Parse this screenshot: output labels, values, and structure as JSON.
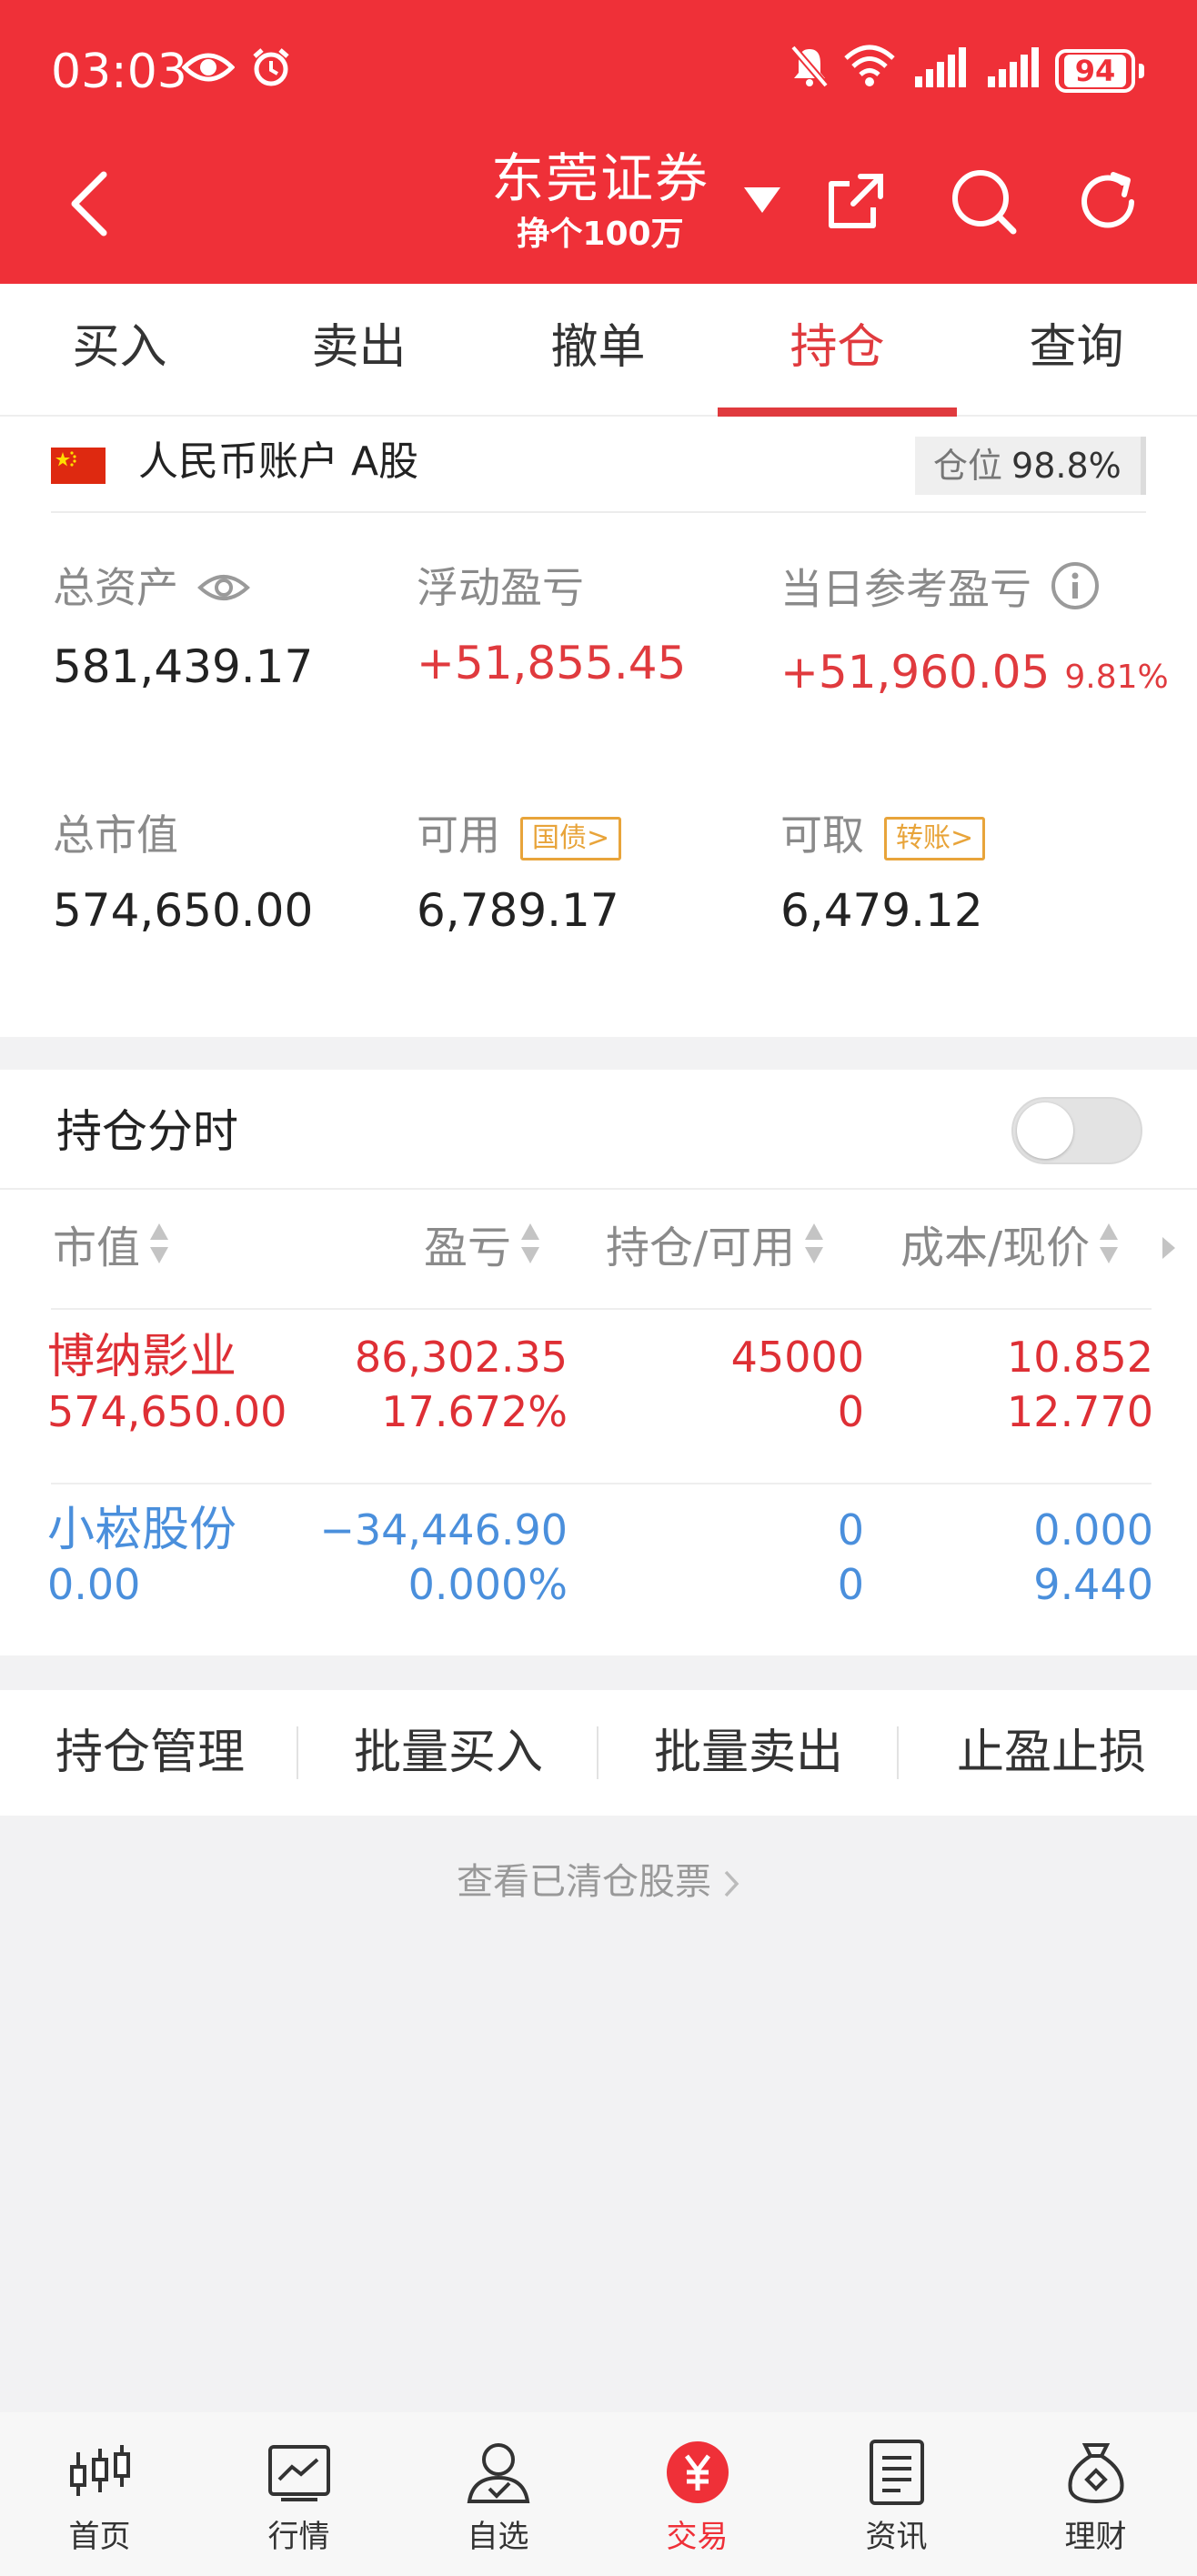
{
  "status_bar": {
    "time": "03:03",
    "battery": "94",
    "icons": [
      "eye-icon",
      "alarm-icon",
      "bell-off-icon",
      "wifi-icon",
      "signal-icon",
      "signal-icon",
      "battery-icon"
    ]
  },
  "nav": {
    "title": "东莞证券",
    "subtitle": "挣个100万",
    "icons": [
      "back-icon",
      "dropdown-caret-icon",
      "share-icon",
      "search-icon",
      "refresh-icon"
    ]
  },
  "tabs": [
    {
      "label": "买入"
    },
    {
      "label": "卖出"
    },
    {
      "label": "撤单"
    },
    {
      "label": "持仓",
      "active": true
    },
    {
      "label": "查询"
    }
  ],
  "account": {
    "name": "人民币账户 A股",
    "position_label": "仓位",
    "position_value": "98.8%",
    "total_assets_label": "总资产",
    "total_assets": "581,439.17",
    "floating_pl_label": "浮动盈亏",
    "floating_pl": "+51,855.45",
    "daily_pl_label": "当日参考盈亏",
    "daily_pl": "+51,960.05",
    "daily_pl_pct": "9.81%",
    "market_value_label": "总市值",
    "market_value": "574,650.00",
    "available_label": "可用",
    "available_tag": "国债>",
    "available": "6,789.17",
    "withdrawable_label": "可取",
    "withdrawable_tag": "转账>",
    "withdrawable": "6,479.12"
  },
  "holdings": {
    "title": "持仓分时",
    "toggle_on": false,
    "columns": [
      "市值",
      "盈亏",
      "持仓/可用",
      "成本/现价"
    ],
    "rows": [
      {
        "name": "博纳影业",
        "market_value": "574,650.00",
        "pl": "86,302.35",
        "pl_pct": "17.672%",
        "position": "45000",
        "available": "0",
        "cost": "10.852",
        "price": "12.770",
        "color": "#de2f35"
      },
      {
        "name": "小崧股份",
        "market_value": "0.00",
        "pl": "−34,446.90",
        "pl_pct": "0.000%",
        "position": "0",
        "available": "0",
        "cost": "0.000",
        "price": "9.440",
        "color": "#4a8fdc"
      }
    ]
  },
  "actions": [
    "持仓管理",
    "批量买入",
    "批量卖出",
    "止盈止损"
  ],
  "view_closed": "查看已清仓股票",
  "bottom_nav": [
    {
      "label": "首页",
      "icon": "candlestick-icon"
    },
    {
      "label": "行情",
      "icon": "chart-icon"
    },
    {
      "label": "自选",
      "icon": "user-watch-icon"
    },
    {
      "label": "交易",
      "icon": "yuan-icon",
      "active": true
    },
    {
      "label": "资讯",
      "icon": "document-icon"
    },
    {
      "label": "理财",
      "icon": "money-bag-icon"
    }
  ],
  "colors": {
    "brand_red": "#ef3038",
    "gain_red": "#de2f35",
    "loss_blue": "#4a8fdc",
    "tag_orange": "#e8a43a"
  }
}
